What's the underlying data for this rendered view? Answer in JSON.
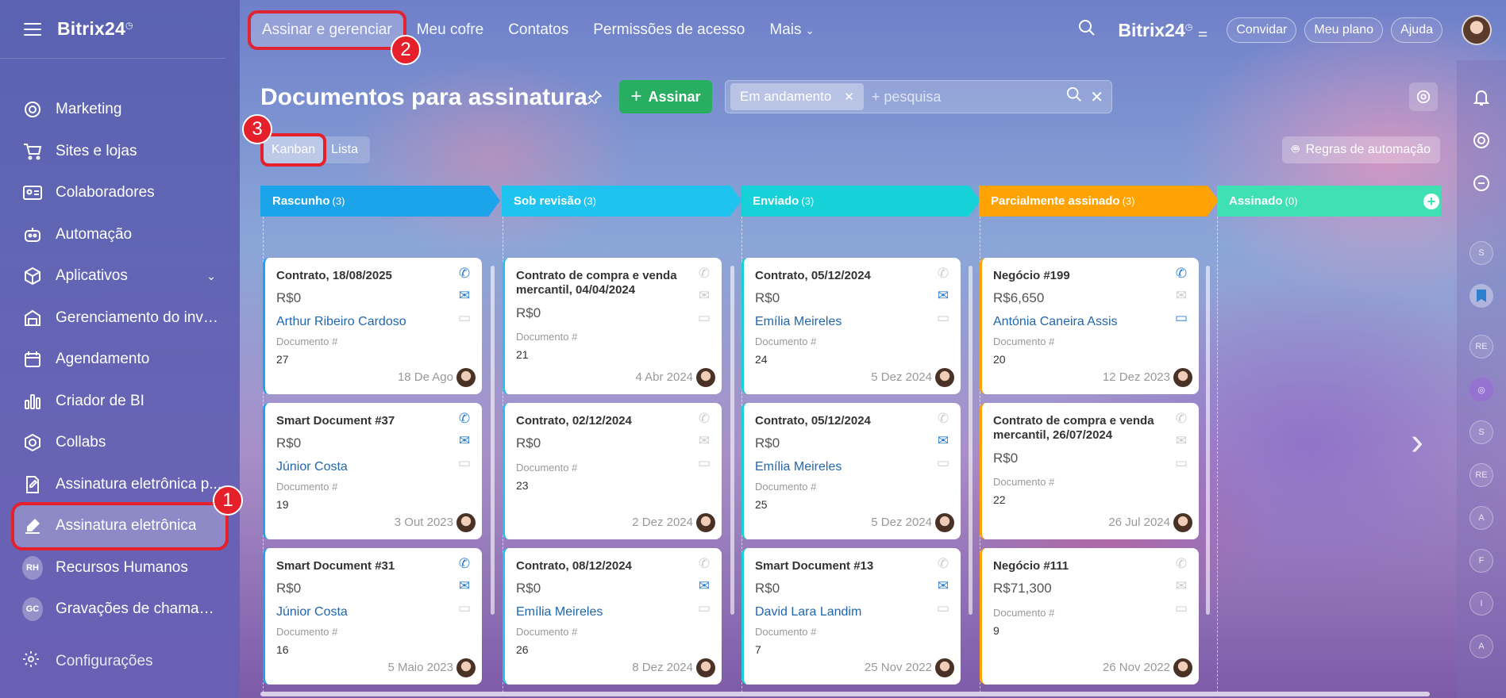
{
  "app": {
    "logo": "Bitrix24",
    "logo_sup": "◷"
  },
  "sidebar": {
    "items": [
      {
        "label": "Marketing",
        "icon": "target-icon"
      },
      {
        "label": "Sites e lojas",
        "icon": "cart-icon"
      },
      {
        "label": "Colaboradores",
        "icon": "id-card-icon"
      },
      {
        "label": "Automação",
        "icon": "robot-icon"
      },
      {
        "label": "Aplicativos",
        "icon": "cube-icon"
      },
      {
        "label": "Gerenciamento do inve...",
        "icon": "inventory-icon"
      },
      {
        "label": "Agendamento",
        "icon": "calendar-icon"
      },
      {
        "label": "Criador de BI",
        "icon": "bar-chart-icon"
      },
      {
        "label": "Collabs",
        "icon": "collabs-icon"
      },
      {
        "label": "Assinatura eletrônica p...",
        "icon": "document-sign-icon"
      },
      {
        "label": "Assinatura eletrônica",
        "icon": "pen-sign-icon"
      },
      {
        "label": "Recursos Humanos",
        "initials": "RH"
      },
      {
        "label": "Gravações de chamadas",
        "initials": "GC"
      }
    ],
    "settings": "Configurações"
  },
  "topnav": {
    "items": [
      "Assinar e gerenciar",
      "Meu cofre",
      "Contatos",
      "Permissões de acesso",
      "Mais"
    ],
    "logo": "Bitrix24",
    "invite": "Convidar",
    "plan": "Meu plano",
    "help": "Ajuda"
  },
  "page": {
    "title": "Documentos para assinatura",
    "sign_button": "Assinar",
    "filter_chip": "Em andamento",
    "search_placeholder": "+ pesquisa",
    "view_kanban": "Kanban",
    "view_list": "Lista",
    "automation_rules": "Regras de automação"
  },
  "steps": [
    "1",
    "2",
    "3"
  ],
  "columns": [
    {
      "title": "Rascunho",
      "count": "(3)",
      "color": "#1ba4ea"
    },
    {
      "title": "Sob revisão",
      "count": "(3)",
      "color": "#1ec3f0"
    },
    {
      "title": "Enviado",
      "count": "(3)",
      "color": "#16d1d8"
    },
    {
      "title": "Parcialmente assinado",
      "count": "(3)",
      "color": "#ffa305"
    },
    {
      "title": "Assinado",
      "count": "(0)",
      "color": "#3ee0b4"
    }
  ],
  "cards": [
    [
      {
        "title": "Contrato, 18/08/2025",
        "amount": "R$0",
        "client": "Arthur Ribeiro Cardoso",
        "doc_label": "Documento #",
        "doc_num": "27",
        "date": "18 De Ago"
      },
      {
        "title": "Smart Document #37",
        "amount": "R$0",
        "client": "Júnior Costa",
        "doc_label": "Documento #",
        "doc_num": "19",
        "date": "3 Out 2023"
      },
      {
        "title": "Smart Document #31",
        "amount": "R$0",
        "client": "Júnior Costa",
        "doc_label": "Documento #",
        "doc_num": "16",
        "date": "5 Maio 2023"
      }
    ],
    [
      {
        "title": "Contrato de compra e venda mercantil, 04/04/2024",
        "amount": "R$0",
        "client": "",
        "doc_label": "Documento #",
        "doc_num": "21",
        "date": "4 Abr 2024"
      },
      {
        "title": "Contrato, 02/12/2024",
        "amount": "R$0",
        "client": "",
        "doc_label": "Documento #",
        "doc_num": "23",
        "date": "2 Dez 2024"
      },
      {
        "title": "Contrato, 08/12/2024",
        "amount": "R$0",
        "client": "Emília Meireles",
        "doc_label": "Documento #",
        "doc_num": "26",
        "date": "8 Dez 2024"
      }
    ],
    [
      {
        "title": "Contrato, 05/12/2024",
        "amount": "R$0",
        "client": "Emília Meireles",
        "doc_label": "Documento #",
        "doc_num": "24",
        "date": "5 Dez 2024"
      },
      {
        "title": "Contrato, 05/12/2024",
        "amount": "R$0",
        "client": "Emília Meireles",
        "doc_label": "Documento #",
        "doc_num": "25",
        "date": "5 Dez 2024"
      },
      {
        "title": "Smart Document #13",
        "amount": "R$0",
        "client": "David Lara Landim",
        "doc_label": "Documento #",
        "doc_num": "7",
        "date": "25 Nov 2022"
      }
    ],
    [
      {
        "title": "Negócio #199",
        "amount": "R$6,650",
        "client": "Antónia Caneira Assis",
        "doc_label": "Documento #",
        "doc_num": "20",
        "date": "12 Dez 2023"
      },
      {
        "title": "Contrato de compra e venda mercantil, 26/07/2024",
        "amount": "R$0",
        "client": "",
        "doc_label": "Documento #",
        "doc_num": "22",
        "date": "26 Jul 2024"
      },
      {
        "title": "Negócio #111",
        "amount": "R$71,300",
        "client": "",
        "doc_label": "Documento #",
        "doc_num": "9",
        "date": "26 Nov 2022"
      }
    ]
  ],
  "rail": [
    "S",
    "RE",
    "S",
    "RE",
    "A",
    "F",
    "I",
    "A"
  ]
}
